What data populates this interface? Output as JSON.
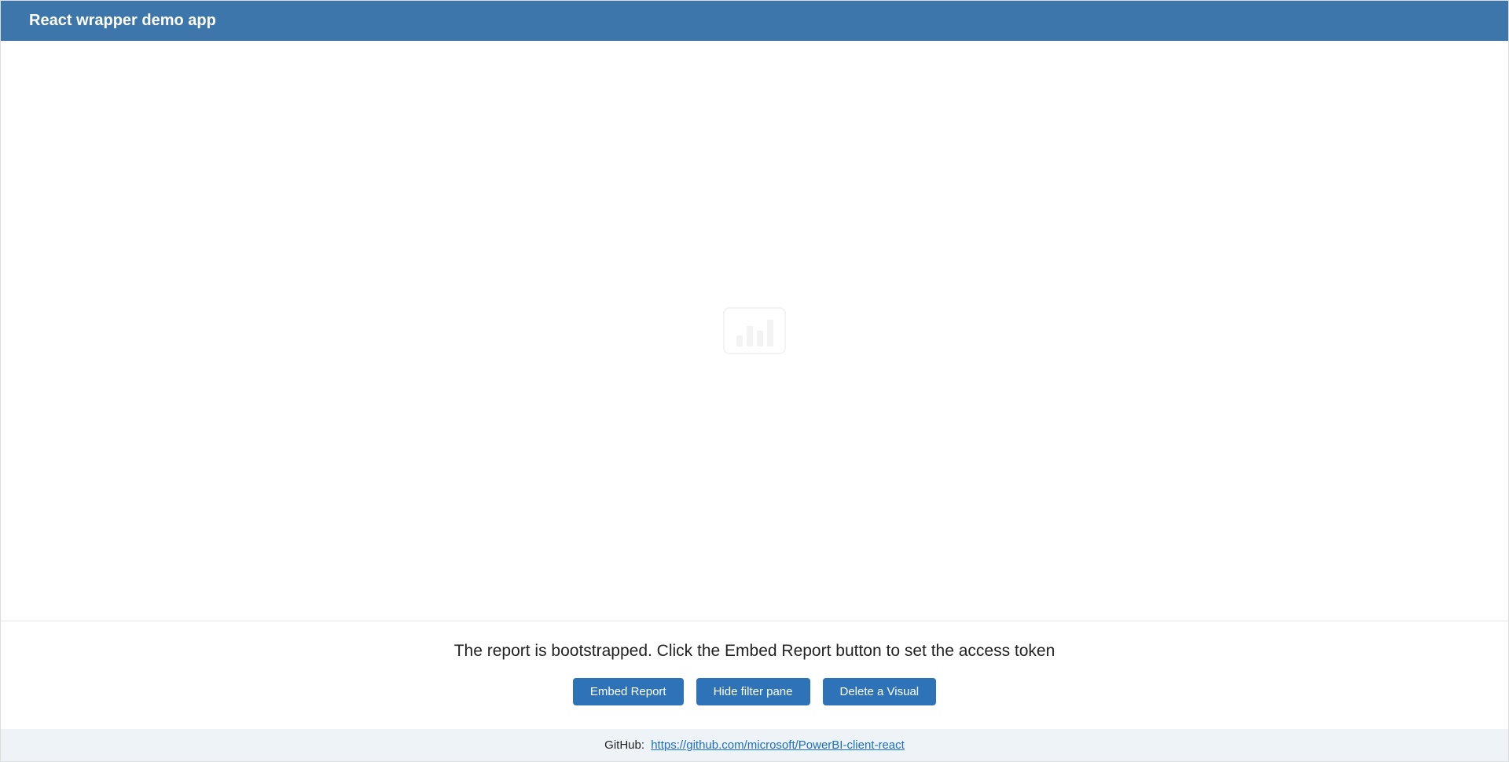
{
  "header": {
    "title": "React wrapper demo app"
  },
  "report": {
    "placeholder_icon": "powerbi-bars-icon"
  },
  "controls": {
    "status_message": "The report is bootstrapped. Click the Embed Report button to set the access token",
    "buttons": {
      "embed": "Embed Report",
      "hide_filter": "Hide filter pane",
      "delete_visual": "Delete a Visual"
    }
  },
  "footer": {
    "label": "GitHub:",
    "link_text": "https://github.com/microsoft/PowerBI-client-react",
    "link_href": "https://github.com/microsoft/PowerBI-client-react"
  }
}
